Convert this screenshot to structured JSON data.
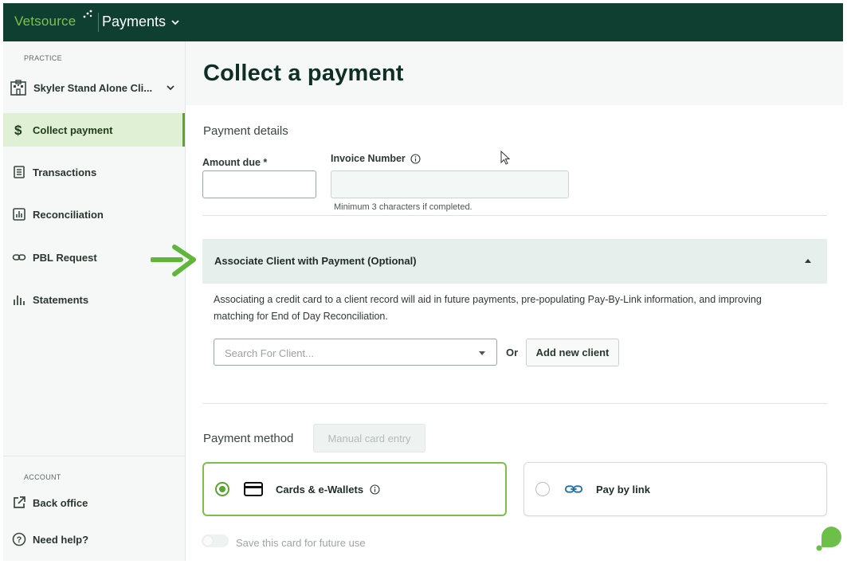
{
  "topbar": {
    "brand": "Vetsource",
    "app_menu_label": "Payments",
    "bg_color": "#0f3f31",
    "brand_color": "#7cc24a"
  },
  "sidebar": {
    "practice_section_label": "PRACTICE",
    "practice_name": "Skyler Stand Alone Cli...",
    "items": [
      {
        "label": "Collect payment",
        "icon": "dollar-icon",
        "active": true
      },
      {
        "label": "Transactions",
        "icon": "receipt-icon",
        "active": false
      },
      {
        "label": "Reconciliation",
        "icon": "chart-box-icon",
        "active": false
      },
      {
        "label": "PBL Request",
        "icon": "link-icon",
        "active": false
      },
      {
        "label": "Statements",
        "icon": "bar-chart-icon",
        "active": false
      }
    ],
    "account_section_label": "ACCOUNT",
    "account_items": [
      {
        "label": "Back office",
        "icon": "external-link-icon"
      },
      {
        "label": "Need help?",
        "icon": "help-circle-icon"
      }
    ]
  },
  "main": {
    "page_title": "Collect a payment",
    "payment_details": {
      "section_title": "Payment details",
      "amount_label": "Amount due *",
      "amount_value": "",
      "invoice_label": "Invoice Number",
      "invoice_value": "",
      "invoice_helper": "Minimum 3 characters if completed."
    },
    "associate_client": {
      "accordion_label": "Associate Client with Payment (Optional)",
      "description": "Associating a credit card to a client record will aid in future payments, pre-populating Pay-By-Link information, and improving matching for End of Day Reconciliation.",
      "search_placeholder": "Search For Client...",
      "or_text": "Or",
      "add_client_label": "Add new client"
    },
    "payment_method": {
      "section_title": "Payment method",
      "manual_entry_label": "Manual card entry",
      "options": [
        {
          "label": "Cards & e-Wallets",
          "selected": true
        },
        {
          "label": "Pay by link",
          "selected": false
        }
      ],
      "save_card_label": "Save this card for future use",
      "save_card_enabled": false
    },
    "accent_color": "#5aa52d"
  }
}
